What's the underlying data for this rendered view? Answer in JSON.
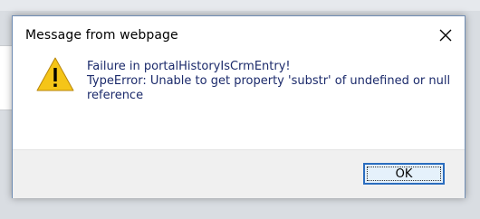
{
  "dialog": {
    "title": "Message from webpage",
    "icon": "warning-icon",
    "message_lines": [
      "Failure in portalHistoryIsCrmEntry!",
      "TypeError: Unable to get property 'substr' of undefined or null reference"
    ],
    "ok_label": "OK",
    "close_icon": "close-icon"
  },
  "colors": {
    "message_text": "#1b2a6b",
    "warning_fill": "#f5c518",
    "button_border": "#2b6dbf",
    "footer_bg": "#f0f0f0"
  }
}
